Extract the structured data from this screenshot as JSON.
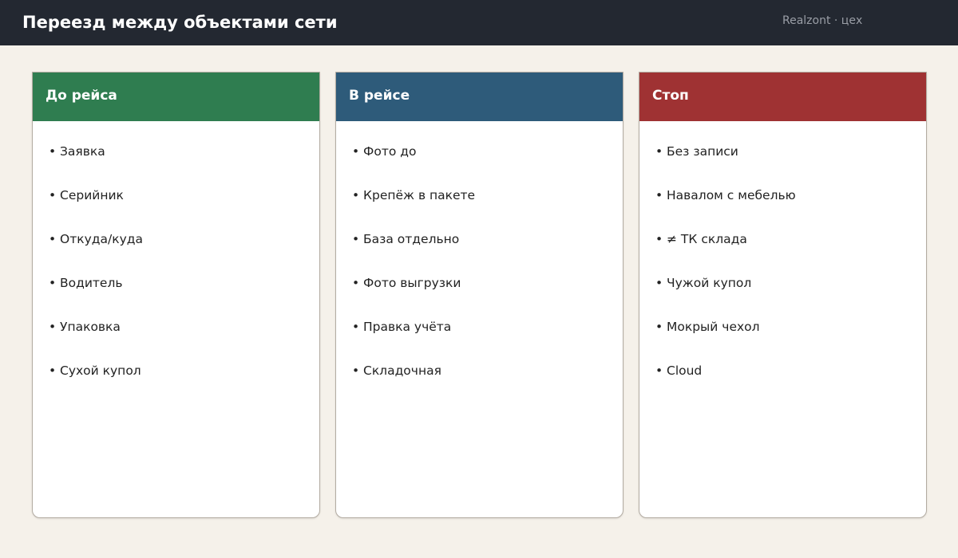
{
  "header": {
    "title": "Переезд между объектами сети",
    "brand": "Realzont · цех"
  },
  "colors": {
    "topbar": "#232831",
    "background": "#f5f1ea",
    "column_before": "#2f7d50",
    "column_during": "#2e5b7a",
    "column_stop": "#9f3233"
  },
  "columns": [
    {
      "title": "До рейса",
      "items": [
        "Заявка",
        "Серийник",
        "Откуда/куда",
        "Водитель",
        "Упаковка",
        "Сухой купол"
      ]
    },
    {
      "title": "В рейсе",
      "items": [
        "Фото до",
        "Крепёж в пакете",
        "База отдельно",
        "Фото выгрузки",
        "Правка учёта",
        "Складочная"
      ]
    },
    {
      "title": "Стоп",
      "items": [
        "Без записи",
        "Навалом с мебелью",
        "≠ ТК склада",
        "Чужой купол",
        "Мокрый чехол",
        "Cloud"
      ]
    }
  ]
}
